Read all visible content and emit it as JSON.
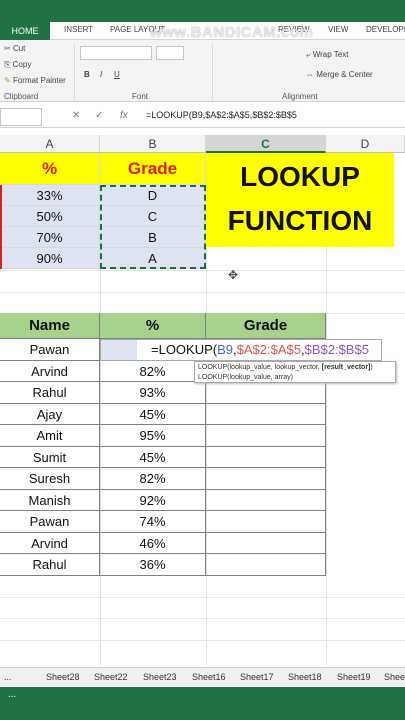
{
  "ribbon_tabs": [
    "HOME",
    "INSERT",
    "PAGE LAYOUT",
    "REVIEW",
    "VIEW",
    "DEVELOPER"
  ],
  "watermark": "www.BANDICAM.com",
  "ribbon": {
    "cut": "Cut",
    "copy": "Copy",
    "format_painter": "Format Painter",
    "clipboard": "Clipboard",
    "font_group": "Font",
    "alignment_group": "Alignment",
    "wrap_text": "Wrap Text",
    "merge_center": "Merge & Center",
    "bold": "B",
    "italic": "I",
    "underline": "U"
  },
  "formula_bar": {
    "fx": "fx",
    "content": "=LOOKUP(B9,$A$2:$A$5,$B$2:$B$5"
  },
  "columns": [
    "A",
    "B",
    "C",
    "D"
  ],
  "lookup_table": {
    "headers": [
      "%",
      "Grade"
    ],
    "rows": [
      [
        "33%",
        "D"
      ],
      [
        "50%",
        "C"
      ],
      [
        "70%",
        "B"
      ],
      [
        "90%",
        "A"
      ]
    ]
  },
  "title_box": {
    "line1": "LOOKUP",
    "line2": "FUNCTION"
  },
  "student_table": {
    "headers": [
      "Name",
      "%",
      "Grade"
    ],
    "rows": [
      [
        "Pawan",
        "",
        ""
      ],
      [
        "Arvind",
        "82%",
        ""
      ],
      [
        "Rahul",
        "93%",
        ""
      ],
      [
        "Ajay",
        "45%",
        ""
      ],
      [
        "Amit",
        "95%",
        ""
      ],
      [
        "Sumit",
        "45%",
        ""
      ],
      [
        "Suresh",
        "82%",
        ""
      ],
      [
        "Manish",
        "92%",
        ""
      ],
      [
        "Pawan",
        "74%",
        ""
      ],
      [
        "Arvind",
        "46%",
        ""
      ],
      [
        "Rahul",
        "36%",
        ""
      ]
    ]
  },
  "editing_formula": {
    "prefix": "=LOOKUP(",
    "arg1": "B9",
    "arg2": "$A$2:$A$5",
    "arg3": "$B$2:$B$5"
  },
  "tooltip": {
    "line1_a": "LOOKUP(lookup_value, lookup_vector, ",
    "line1_b": "[result_vector]",
    "line1_c": ")",
    "line2": "LOOKUP(lookup_value, array)"
  },
  "sheet_tabs": [
    "...",
    "Sheet28",
    "Sheet22",
    "Sheet23",
    "Sheet16",
    "Sheet17",
    "Sheet18",
    "Sheet19",
    "Sheet"
  ],
  "status_ready": "..."
}
